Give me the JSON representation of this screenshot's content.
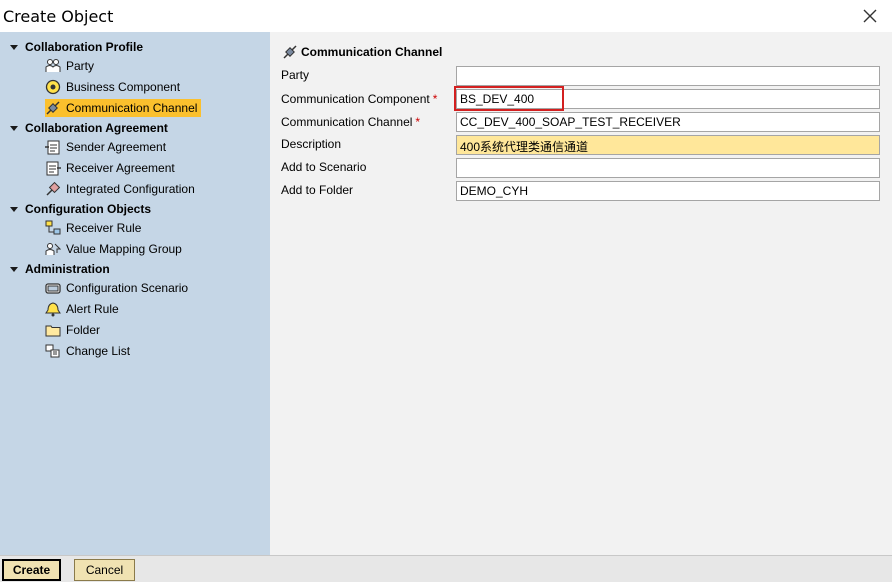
{
  "window": {
    "title": "Create Object"
  },
  "sidebar": {
    "groups": [
      {
        "label": "Collaboration Profile",
        "items": [
          {
            "label": "Party",
            "icon": "party-icon"
          },
          {
            "label": "Business Component",
            "icon": "business-component-icon"
          },
          {
            "label": "Communication Channel",
            "icon": "communication-channel-icon",
            "selected": true
          }
        ]
      },
      {
        "label": "Collaboration Agreement",
        "items": [
          {
            "label": "Sender Agreement",
            "icon": "sender-agreement-icon"
          },
          {
            "label": "Receiver Agreement",
            "icon": "receiver-agreement-icon"
          },
          {
            "label": "Integrated Configuration",
            "icon": "integrated-configuration-icon"
          }
        ]
      },
      {
        "label": "Configuration Objects",
        "items": [
          {
            "label": "Receiver Rule",
            "icon": "receiver-rule-icon"
          },
          {
            "label": "Value Mapping Group",
            "icon": "value-mapping-group-icon"
          }
        ]
      },
      {
        "label": "Administration",
        "items": [
          {
            "label": "Configuration Scenario",
            "icon": "configuration-scenario-icon"
          },
          {
            "label": "Alert Rule",
            "icon": "alert-rule-icon"
          },
          {
            "label": "Folder",
            "icon": "folder-icon"
          },
          {
            "label": "Change List",
            "icon": "change-list-icon"
          }
        ]
      }
    ]
  },
  "main": {
    "section_title": "Communication Channel",
    "required_marker": "*",
    "fields": [
      {
        "label": "Party",
        "value": "",
        "required": false
      },
      {
        "label": "Communication Component",
        "value": "BS_DEV_400",
        "required": true
      },
      {
        "label": "Communication Channel",
        "value": "CC_DEV_400_SOAP_TEST_RECEIVER",
        "required": true
      },
      {
        "label": "Description",
        "value": "400系统代理类通信通道",
        "required": false
      },
      {
        "label": "Add to Scenario",
        "value": "",
        "required": false
      },
      {
        "label": "Add to Folder",
        "value": "DEMO_CYH",
        "required": false
      }
    ]
  },
  "footer": {
    "create_label": "Create",
    "cancel_label": "Cancel"
  },
  "colors": {
    "sidebar_bg": "#c5d6e6",
    "selected_bg": "#fbc02d",
    "highlight_field": "#ffe79a",
    "annotation_box": "#d32020",
    "button_bg": "#f0e2b2"
  }
}
